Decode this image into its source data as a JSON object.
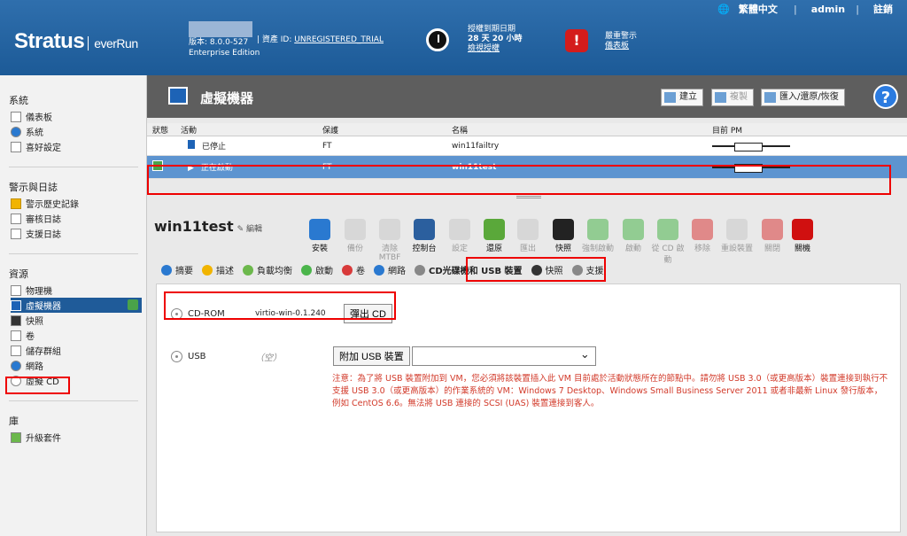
{
  "header": {
    "logo_main": "Stratus",
    "logo_sub": "everRun",
    "version": "版本: 8.0.0-527",
    "edition": "Enterprise Edition",
    "asset_label": "| 資產 ID:",
    "asset_value": "UNREGISTERED_TRIAL",
    "license_line1": "授權到期日期",
    "license_line2": "28 天 20 小時",
    "license_link": "檢視授權",
    "alarm_line1": "嚴重警示",
    "alarm_link": "儀表板",
    "language": "繁體中文",
    "user": "admin",
    "logout": "註銷"
  },
  "sidebar": {
    "groups": [
      {
        "title": "系統",
        "items": [
          {
            "label": "儀表板"
          },
          {
            "label": "系統"
          },
          {
            "label": "喜好設定"
          }
        ]
      },
      {
        "title": "警示與日誌",
        "items": [
          {
            "label": "警示歷史記錄"
          },
          {
            "label": "審核日誌"
          },
          {
            "label": "支援日誌"
          }
        ]
      },
      {
        "title": "資源",
        "items": [
          {
            "label": "物理機"
          },
          {
            "label": "虛擬機器"
          },
          {
            "label": "快照"
          },
          {
            "label": "卷"
          },
          {
            "label": "儲存群組"
          },
          {
            "label": "網路"
          },
          {
            "label": "虛擬 CD"
          }
        ]
      },
      {
        "title": "庫",
        "items": [
          {
            "label": "升級套件"
          }
        ]
      }
    ]
  },
  "page": {
    "title": "虛擬機器",
    "buttons": {
      "create": "建立",
      "copy": "複製",
      "import": "匯入/還原/恢復"
    },
    "help": "?"
  },
  "table": {
    "headers": [
      "狀態",
      "活動",
      "保護",
      "名稱",
      "目前 PM"
    ],
    "rows": [
      {
        "activity": "已停止",
        "protection": "FT",
        "name": "win11failtry"
      },
      {
        "activity": "正在啟動",
        "protection": "FT",
        "name": "win11test"
      }
    ]
  },
  "detail": {
    "vm_name": "win11test",
    "edit": "編輯",
    "actions": [
      {
        "label": "安裝",
        "state": "on"
      },
      {
        "label": "備份",
        "state": "off"
      },
      {
        "label": "清除 MTBF",
        "state": "off"
      },
      {
        "label": "控制台",
        "state": "on"
      },
      {
        "label": "設定",
        "state": "off"
      },
      {
        "label": "還原",
        "state": "on"
      },
      {
        "label": "匯出",
        "state": "off"
      },
      {
        "label": "快照",
        "state": "on"
      },
      {
        "label": "強制啟動",
        "state": "off"
      },
      {
        "label": "啟動",
        "state": "off"
      },
      {
        "label": "從 CD 啟動",
        "state": "off"
      },
      {
        "label": "移除",
        "state": "off"
      },
      {
        "label": "重設裝置",
        "state": "off"
      },
      {
        "label": "關閉",
        "state": "off"
      },
      {
        "label": "關機",
        "state": "on"
      }
    ],
    "tabs": [
      {
        "label": "摘要"
      },
      {
        "label": "描述"
      },
      {
        "label": "負載均衡"
      },
      {
        "label": "啟動"
      },
      {
        "label": "卷"
      },
      {
        "label": "網路"
      },
      {
        "label": "CD光碟機和 USB 裝置"
      },
      {
        "label": "快照"
      },
      {
        "label": "支援"
      }
    ],
    "cd": {
      "label": "CD-ROM",
      "iso": "virtio-win-0.1.240",
      "eject": "彈出 CD"
    },
    "usb": {
      "label": "USB",
      "value": "（空）",
      "attach": "附加 USB 裝置"
    },
    "notice": "注意：為了將 USB 裝置附加到 VM，您必須將該裝置插入此 VM 目前處於活動狀態所在的節點中。請勿將 USB 3.0（或更高版本）裝置連接到執行不支援 USB 3.0（或更高版本）的作業系統的 VM：Windows 7 Desktop、Windows Small Business Server 2011 或者非最新 Linux 發行版本，例如 CentOS 6.6。無法將 USB 連接的 SCSI (UAS) 裝置連接到客人。"
  },
  "colors": {
    "accent": "#1f5b99",
    "selected_row": "#5d94d0",
    "highlight": "#e00000",
    "notice": "#d23a2a"
  }
}
